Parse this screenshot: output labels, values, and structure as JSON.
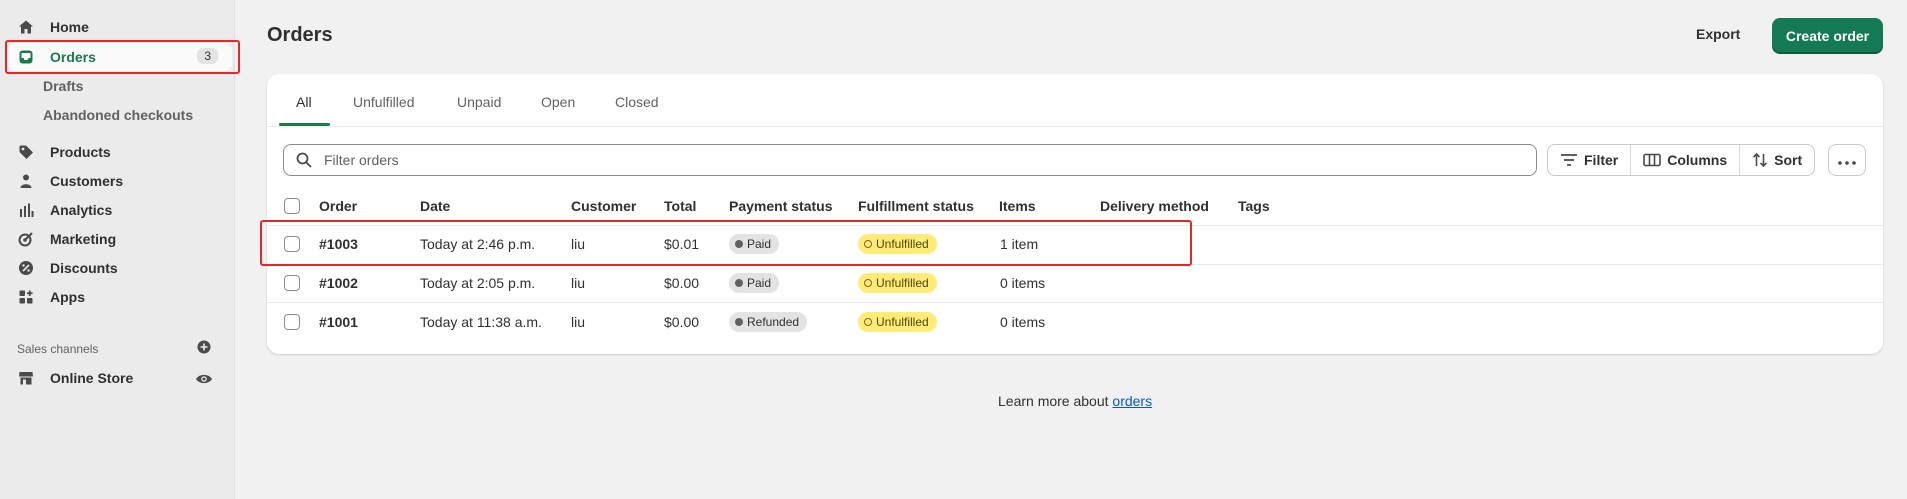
{
  "sidebar": {
    "home": "Home",
    "orders": "Orders",
    "orders_badge": "3",
    "drafts": "Drafts",
    "abandoned": "Abandoned checkouts",
    "products": "Products",
    "customers": "Customers",
    "analytics": "Analytics",
    "marketing": "Marketing",
    "discounts": "Discounts",
    "apps": "Apps",
    "sales_channels": "Sales channels",
    "online_store": "Online Store"
  },
  "header": {
    "title": "Orders",
    "export": "Export",
    "create": "Create order"
  },
  "tabs": [
    "All",
    "Unfulfilled",
    "Unpaid",
    "Open",
    "Closed"
  ],
  "toolbar": {
    "search_placeholder": "Filter orders",
    "filter": "Filter",
    "columns": "Columns",
    "sort": "Sort"
  },
  "table": {
    "columns": [
      "Order",
      "Date",
      "Customer",
      "Total",
      "Payment status",
      "Fulfillment status",
      "Items",
      "Delivery method",
      "Tags"
    ],
    "rows": [
      {
        "order": "#1003",
        "date": "Today at 2:46 p.m.",
        "customer": "liu",
        "total": "$0.01",
        "payment": "Paid",
        "fulfillment": "Unfulfilled",
        "items": "1 item"
      },
      {
        "order": "#1002",
        "date": "Today at 2:05 p.m.",
        "customer": "liu",
        "total": "$0.00",
        "payment": "Paid",
        "fulfillment": "Unfulfilled",
        "items": "0 items"
      },
      {
        "order": "#1001",
        "date": "Today at 11:38 a.m.",
        "customer": "liu",
        "total": "$0.00",
        "payment": "Refunded",
        "fulfillment": "Unfulfilled",
        "items": "0 items"
      }
    ]
  },
  "footer": {
    "learn_prefix": "Learn more about ",
    "learn_link": "orders"
  },
  "colors": {
    "accent": "#1a7a4c",
    "primary_button": "#147a55",
    "highlight": "#e3282a"
  }
}
